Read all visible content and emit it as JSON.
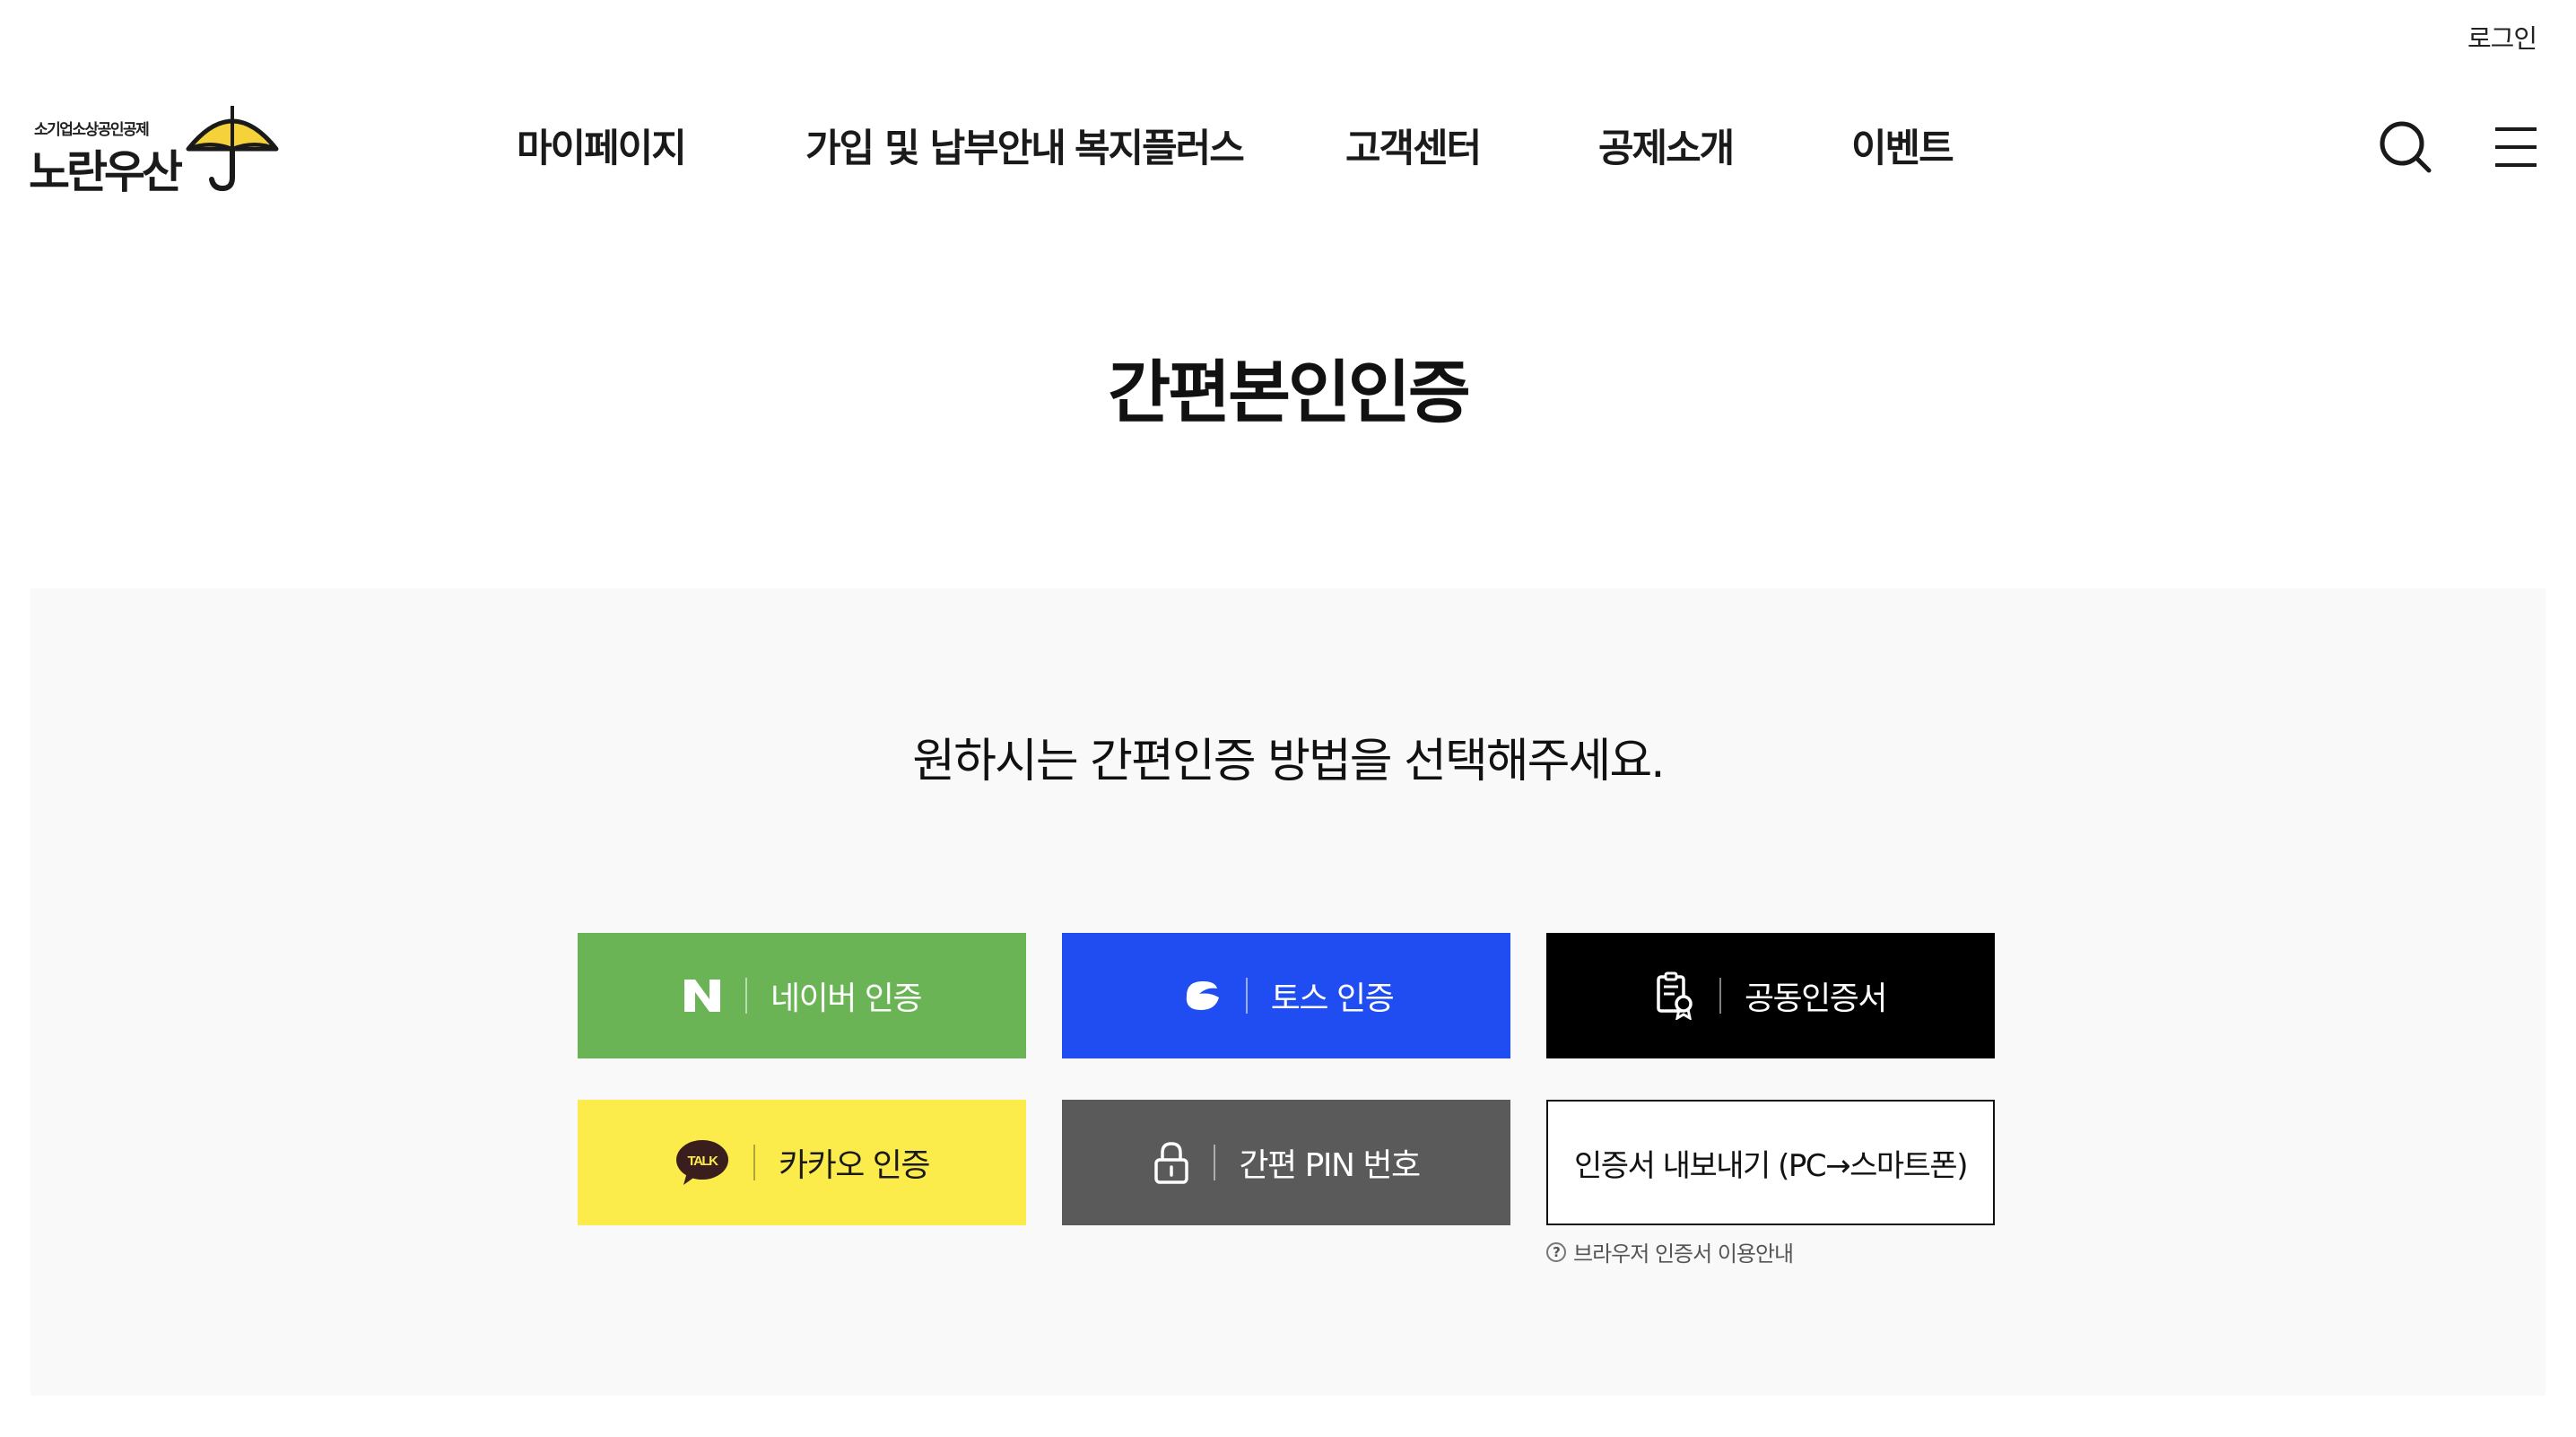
{
  "header": {
    "login_label": "로그인",
    "logo_sub": "소기업소상공인공제",
    "logo_main": "노란우산",
    "logo_color": "#f6d23a",
    "nav": [
      {
        "label": "마이페이지"
      },
      {
        "label": "가입 및 납부안내"
      },
      {
        "label": "복지플러스"
      },
      {
        "label": "고객센터"
      },
      {
        "label": "공제소개"
      },
      {
        "label": "이벤트"
      }
    ],
    "search_icon": "search-icon",
    "menu_icon": "hamburger-menu-icon"
  },
  "main": {
    "title": "간편본인인증",
    "instruction": "원하시는 간편인증 방법을 선택해주세요.",
    "buttons": {
      "naver": {
        "label": "네이버 인증",
        "icon": "naver-n-icon",
        "color": "#6ab456"
      },
      "toss": {
        "label": "토스 인증",
        "icon": "toss-icon",
        "color": "#1f4df2"
      },
      "cert": {
        "label": "공동인증서",
        "icon": "certificate-icon",
        "color": "#000000"
      },
      "kakao": {
        "label": "카카오 인증",
        "icon": "kakao-talk-icon",
        "icon_text": "TALK",
        "color": "#fbec4b"
      },
      "pin": {
        "label": "간편 PIN 번호",
        "icon": "lock-icon",
        "color": "#5a5a5a"
      },
      "export": {
        "label": "인증서 내보내기 (PC→스마트폰)"
      }
    },
    "help_link": "브라우저 인증서 이용안내",
    "help_icon_glyph": "?"
  }
}
